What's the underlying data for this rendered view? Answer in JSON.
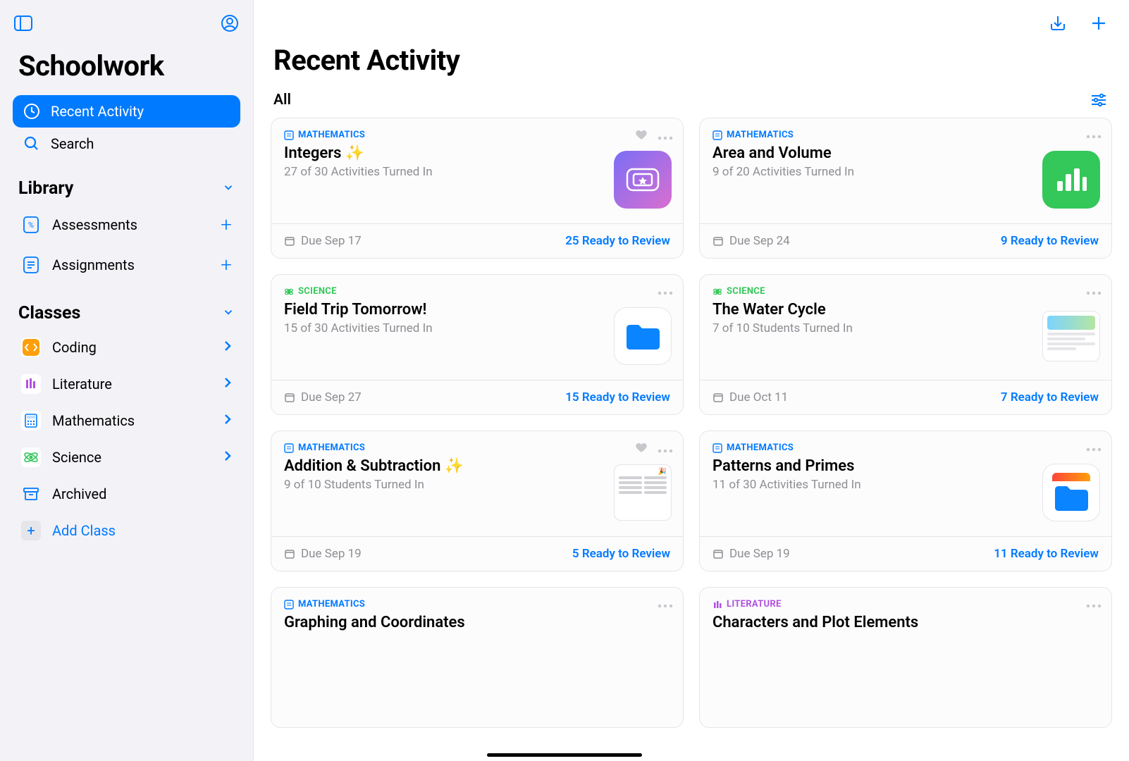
{
  "app": {
    "title": "Schoolwork"
  },
  "sidebar": {
    "nav": [
      {
        "label": "Recent Activity"
      },
      {
        "label": "Search"
      }
    ],
    "library": {
      "title": "Library",
      "items": [
        {
          "label": "Assessments"
        },
        {
          "label": "Assignments"
        }
      ]
    },
    "classes": {
      "title": "Classes",
      "items": [
        {
          "label": "Coding"
        },
        {
          "label": "Literature"
        },
        {
          "label": "Mathematics"
        },
        {
          "label": "Science"
        },
        {
          "label": "Archived"
        }
      ],
      "add_label": "Add Class"
    }
  },
  "main": {
    "title": "Recent Activity",
    "filter": "All"
  },
  "subjects": {
    "mathematics": "MATHEMATICS",
    "science": "SCIENCE",
    "literature": "LITERATURE"
  },
  "cards": [
    {
      "subject": "mathematics",
      "title": "Integers ✨",
      "sub": "27 of 30 Activities Turned In",
      "due": "Due Sep 17",
      "review": "25 Ready to Review",
      "fav": true,
      "thumb": "ticket"
    },
    {
      "subject": "mathematics",
      "title": "Area and Volume",
      "sub": "9 of 20 Activities Turned In",
      "due": "Due Sep 24",
      "review": "9 Ready to Review",
      "fav": false,
      "thumb": "charts"
    },
    {
      "subject": "science",
      "title": "Field Trip Tomorrow!",
      "sub": "15 of 30 Activities Turned In",
      "due": "Due Sep 27",
      "review": "15 Ready to Review",
      "fav": false,
      "thumb": "folder-blue"
    },
    {
      "subject": "science",
      "title": "The Water Cycle",
      "sub": "7 of 10 Students Turned In",
      "due": "Due Oct 11",
      "review": "7 Ready to Review",
      "fav": false,
      "thumb": "doc"
    },
    {
      "subject": "mathematics",
      "title": "Addition & Subtraction ✨",
      "sub": "9 of 10 Students Turned In",
      "due": "Due Sep 19",
      "review": "5 Ready to Review",
      "fav": true,
      "thumb": "worksheet"
    },
    {
      "subject": "mathematics",
      "title": "Patterns and Primes",
      "sub": "11 of 30 Activities Turned In",
      "due": "Due Sep 19",
      "review": "11 Ready to Review",
      "fav": false,
      "thumb": "folder-orange"
    },
    {
      "subject": "mathematics",
      "title": "Graphing and Coordinates",
      "sub": "",
      "due": "",
      "review": "",
      "fav": false,
      "thumb": ""
    },
    {
      "subject": "literature",
      "title": "Characters and Plot Elements",
      "sub": "",
      "due": "",
      "review": "",
      "fav": false,
      "thumb": ""
    }
  ]
}
